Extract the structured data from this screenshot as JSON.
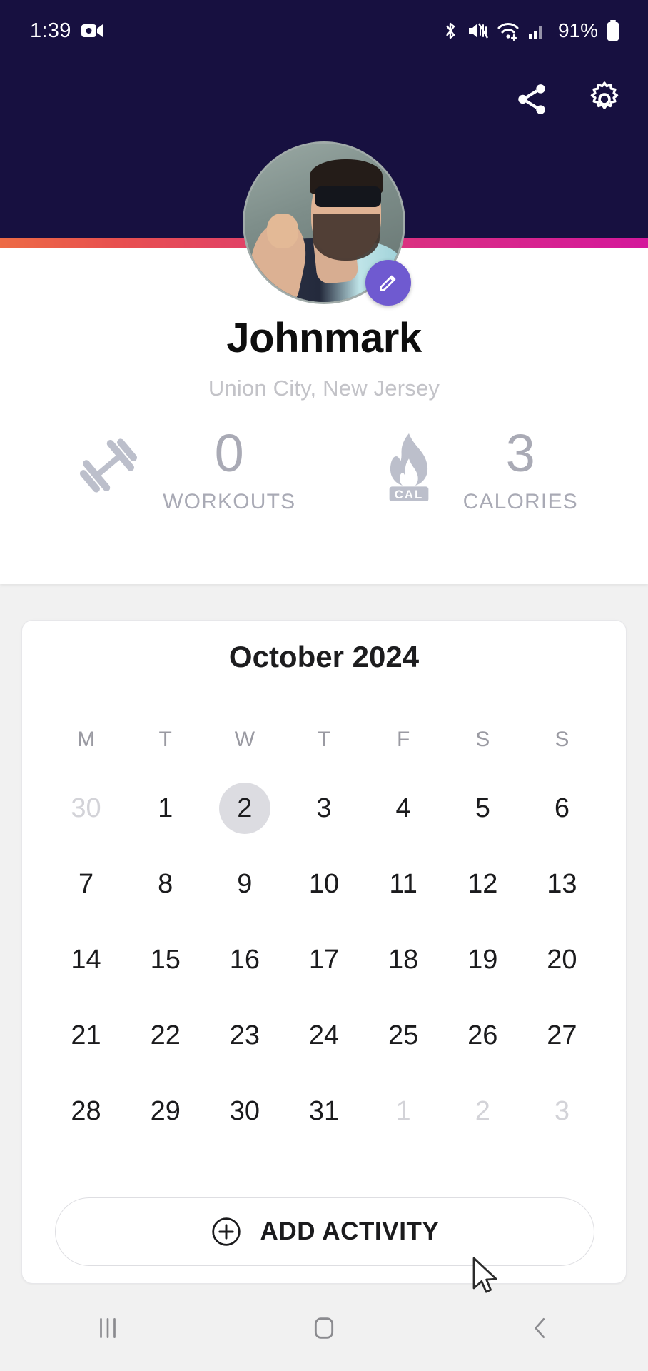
{
  "statusbar": {
    "time": "1:39",
    "battery": "91%",
    "icons": [
      "screen-record-icon",
      "bluetooth-icon",
      "mute-icon",
      "wifi-icon",
      "cellular-signal-icon",
      "battery-icon"
    ]
  },
  "header": {
    "share_label": "share-icon",
    "settings_label": "gear-icon",
    "background_color": "#171040",
    "accent_gradient_start": "#ed6b45",
    "accent_gradient_end": "#d4189b"
  },
  "profile": {
    "name": "Johnmark",
    "location": "Union City, New Jersey",
    "edit_button_color": "#6f5ad0",
    "stats": [
      {
        "icon": "dumbbell-icon",
        "value": "0",
        "label": "WORKOUTS"
      },
      {
        "icon": "flame-cal-icon",
        "value": "3",
        "label": "CALORIES"
      }
    ]
  },
  "calendar": {
    "title": "October 2024",
    "weekdays": [
      "M",
      "T",
      "W",
      "T",
      "F",
      "S",
      "S"
    ],
    "today": 2,
    "weeks": [
      [
        {
          "n": "30",
          "muted": true
        },
        {
          "n": "1"
        },
        {
          "n": "2",
          "today": true
        },
        {
          "n": "3"
        },
        {
          "n": "4"
        },
        {
          "n": "5"
        },
        {
          "n": "6"
        }
      ],
      [
        {
          "n": "7"
        },
        {
          "n": "8"
        },
        {
          "n": "9"
        },
        {
          "n": "10"
        },
        {
          "n": "11"
        },
        {
          "n": "12"
        },
        {
          "n": "13"
        }
      ],
      [
        {
          "n": "14"
        },
        {
          "n": "15"
        },
        {
          "n": "16"
        },
        {
          "n": "17"
        },
        {
          "n": "18"
        },
        {
          "n": "19"
        },
        {
          "n": "20"
        }
      ],
      [
        {
          "n": "21"
        },
        {
          "n": "22"
        },
        {
          "n": "23"
        },
        {
          "n": "24"
        },
        {
          "n": "25"
        },
        {
          "n": "26"
        },
        {
          "n": "27"
        }
      ],
      [
        {
          "n": "28"
        },
        {
          "n": "29"
        },
        {
          "n": "30"
        },
        {
          "n": "31"
        },
        {
          "n": "1",
          "muted": true
        },
        {
          "n": "2",
          "muted": true
        },
        {
          "n": "3",
          "muted": true
        }
      ]
    ],
    "add_activity_label": "ADD ACTIVITY",
    "add_activity_icon": "plus-circle-icon"
  },
  "navbar": {
    "recents": "recents-icon",
    "home": "home-icon",
    "back": "back-icon"
  }
}
